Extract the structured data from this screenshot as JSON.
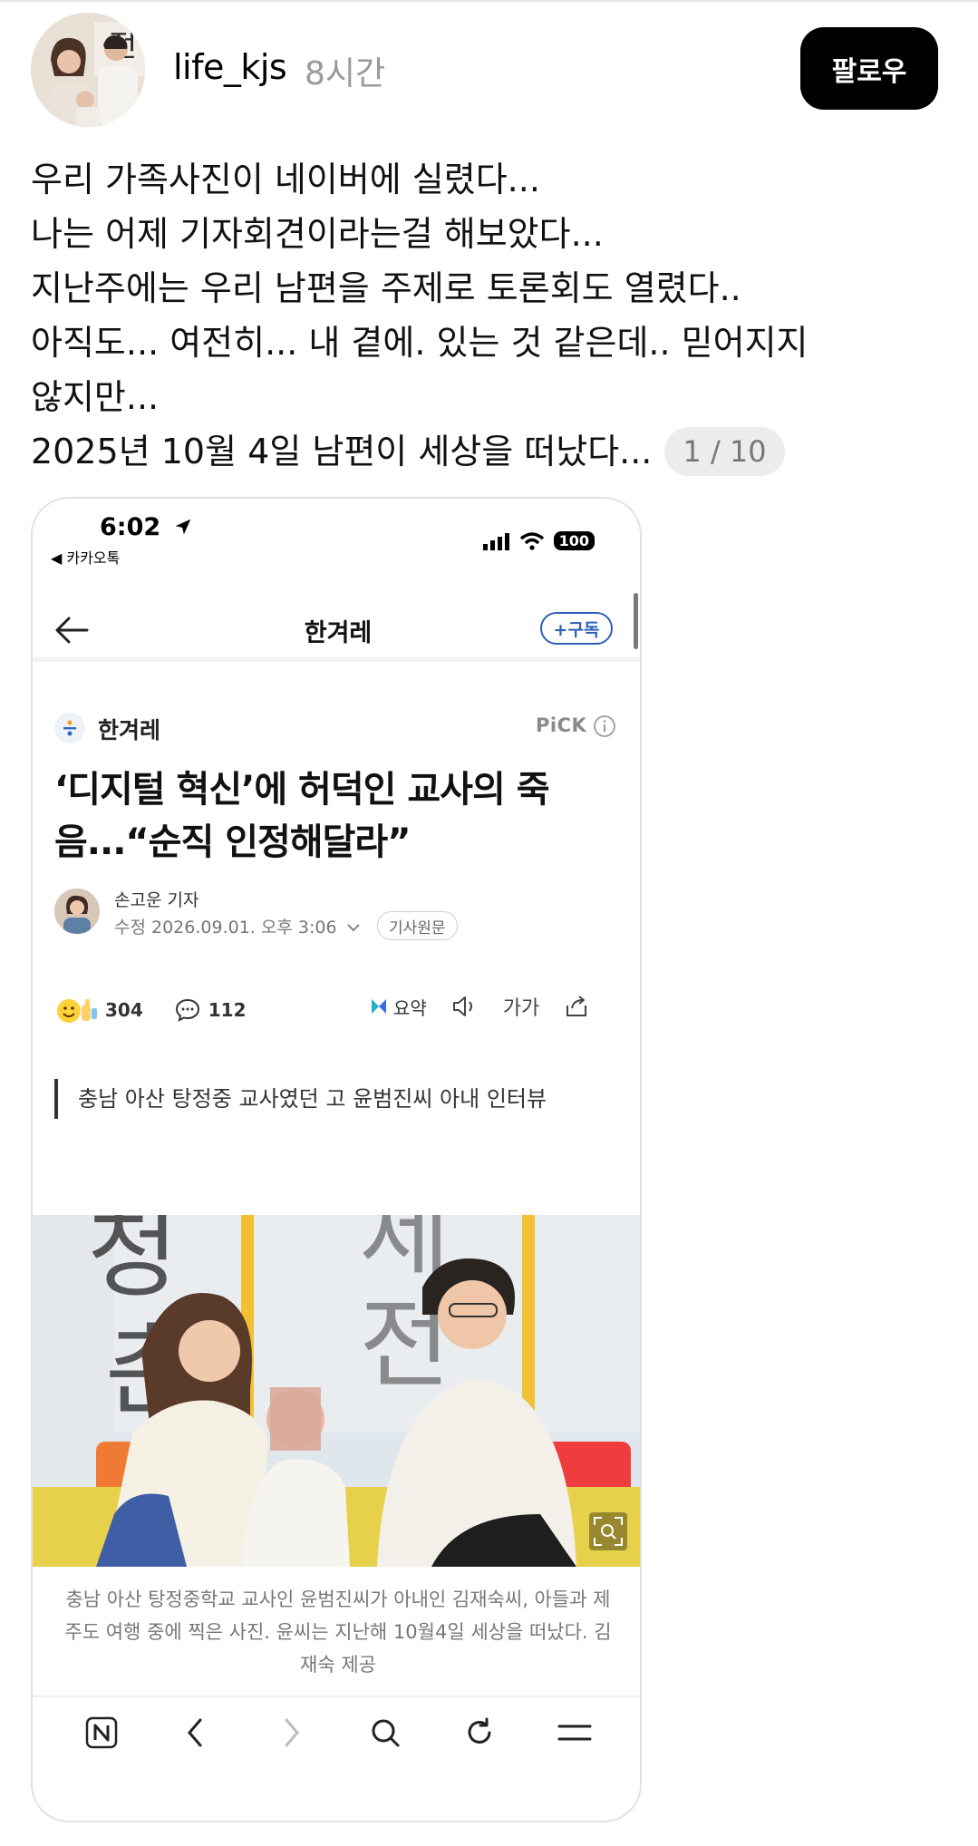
{
  "post": {
    "username": "life_kjs",
    "time": "8시간",
    "follow_label": "팔로우",
    "caption_lines": [
      "우리 가족사진이 네이버에 실렸다...",
      "나는 어제 기자회견이라는걸 해보았다...",
      "지난주에는 우리 남편을 주제로 토론회도 열렸다..",
      "아직도... 여전히... 내 곁에. 있는 것 같은데.. 믿어지지",
      "않지만...",
      "2025년 10월 4일 남편이 세상을 떠났다..."
    ],
    "image_counter": "1 / 10"
  },
  "phone": {
    "status_time": "6:02",
    "status_back_app": "◀ 카카오톡",
    "battery": "100",
    "nav_title": "한겨레",
    "subscribe_label": "+구독",
    "press_name": "한겨레",
    "pick_label": "PiCK",
    "headline": "‘디지털 혁신’에 허덕인 교사의 죽음...“순직 인정해달라”",
    "reporter": "손고운 기자",
    "date": "수정 2026.09.01. 오후 3:06",
    "origin_label": "기사원문",
    "reaction_count": "304",
    "comment_count": "112",
    "summary_label": "요약",
    "font_label": "가가",
    "quote": "충남 아산 탕정중 교사였던 고 윤범진씨 아내 인터뷰",
    "photo_caption": "충남 아산 탕정중학교 교사인 윤범진씨가 아내인 김재숙씨, 아들과 제주도 여행 중에 찍은 사진. 윤씨는 지난해 10월4일 세상을 떠났다. 김재숙 제공",
    "accent_color": "#2f5fb8"
  }
}
